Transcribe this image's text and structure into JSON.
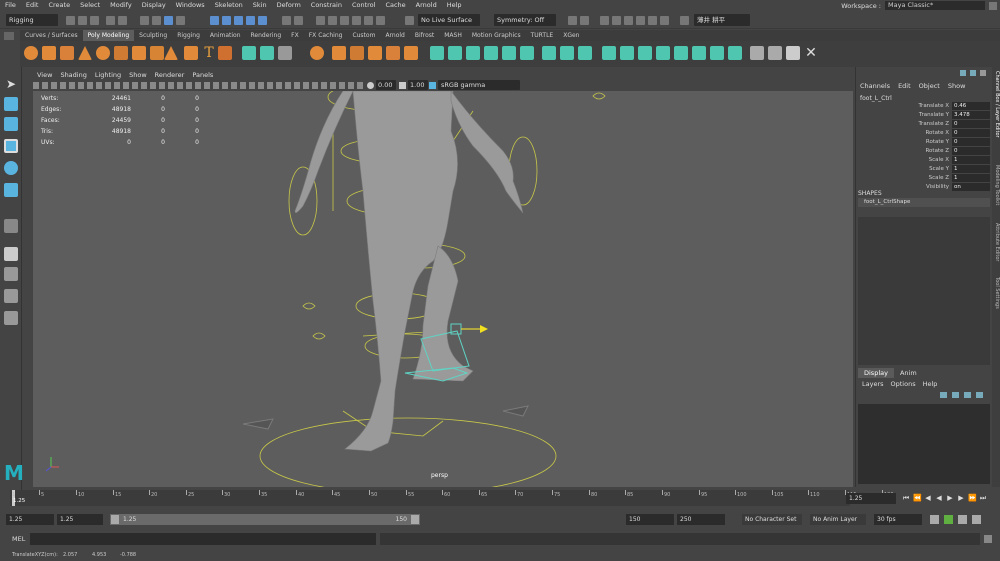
{
  "menubar": {
    "items": [
      "File",
      "Edit",
      "Create",
      "Select",
      "Modify",
      "Display",
      "Windows",
      "Skeleton",
      "Skin",
      "Deform",
      "Constrain",
      "Control",
      "Cache",
      "Arnold",
      "Help"
    ],
    "workspace_label": "Workspace :",
    "workspace_value": "Maya Classic*"
  },
  "status": {
    "menuset": "Rigging",
    "live_surface": "No Live Surface",
    "symmetry": "Symmetry: Off",
    "user": "薄井 耕平"
  },
  "shelf": {
    "tabs": [
      "Curves / Surfaces",
      "Poly Modeling",
      "Sculpting",
      "Rigging",
      "Animation",
      "Rendering",
      "FX",
      "FX Caching",
      "Custom",
      "Arnold",
      "Bifrost",
      "MASH",
      "Motion Graphics",
      "TURTLE",
      "XGen"
    ],
    "active": "Poly Modeling"
  },
  "viewport": {
    "menu": [
      "View",
      "Shading",
      "Lighting",
      "Show",
      "Renderer",
      "Panels"
    ],
    "exposure": "0.00",
    "gamma": "1.00",
    "colorspace": "sRGB gamma",
    "camera": "persp",
    "hud": [
      [
        "Verts:",
        "24461",
        "0",
        "0"
      ],
      [
        "Edges:",
        "48918",
        "0",
        "0"
      ],
      [
        "Faces:",
        "24459",
        "0",
        "0"
      ],
      [
        "Tris:",
        "48918",
        "0",
        "0"
      ],
      [
        "UVs:",
        "0",
        "0",
        "0"
      ]
    ]
  },
  "channelbox": {
    "menu": [
      "Channels",
      "Edit",
      "Object",
      "Show"
    ],
    "object": "foot_L_Ctrl",
    "attributes": [
      {
        "name": "Translate X",
        "value": "0.46"
      },
      {
        "name": "Translate Y",
        "value": "3.478"
      },
      {
        "name": "Translate Z",
        "value": "0"
      },
      {
        "name": "Rotate X",
        "value": "0"
      },
      {
        "name": "Rotate Y",
        "value": "0"
      },
      {
        "name": "Rotate Z",
        "value": "0"
      },
      {
        "name": "Scale X",
        "value": "1"
      },
      {
        "name": "Scale Y",
        "value": "1"
      },
      {
        "name": "Scale Z",
        "value": "1"
      },
      {
        "name": "Visibility",
        "value": "on"
      }
    ],
    "shapes_label": "SHAPES",
    "shape_name": "foot_L_CtrlShape",
    "layer_tabs": [
      "Display",
      "Anim"
    ],
    "layer_menu": [
      "Layers",
      "Options",
      "Help"
    ],
    "side_tabs": [
      "Channel Box / Layer Editor",
      "Modeling Toolkit",
      "Attribute Editor",
      "Tool Settings"
    ]
  },
  "timeline": {
    "ticks": [
      "5",
      "10",
      "15",
      "20",
      "25",
      "30",
      "35",
      "40",
      "45",
      "50",
      "55",
      "60",
      "65",
      "70",
      "75",
      "80",
      "85",
      "90",
      "95",
      "100",
      "105",
      "110",
      "115",
      "120"
    ],
    "start_label": "1",
    "current_frame": "1.25",
    "current_field": "1.25"
  },
  "range": {
    "start": "1.25",
    "start_inner": "1.25",
    "range_start": "1.25",
    "range_end": "150",
    "end_inner": "150",
    "end": "250",
    "character_set": "No Character Set",
    "anim_layer": "No Anim Layer",
    "fps": "30 fps"
  },
  "cmdline": {
    "label": "MEL"
  },
  "helpline": {
    "label": "TranslateXYZ(cm):",
    "x": "2.057",
    "y": "4.953",
    "z": "-0.788"
  },
  "colors": {
    "ui_bg": "#444444",
    "viewport_bg": "#5d5d5d",
    "field_bg": "#2b2b2b",
    "rig_yellow": "#c8c84a",
    "select_cyan": "#5fd4c4",
    "shelf_orange": "#e08a3a",
    "shelf_teal": "#4fc7b0",
    "maya_logo": "#25b0c0"
  }
}
